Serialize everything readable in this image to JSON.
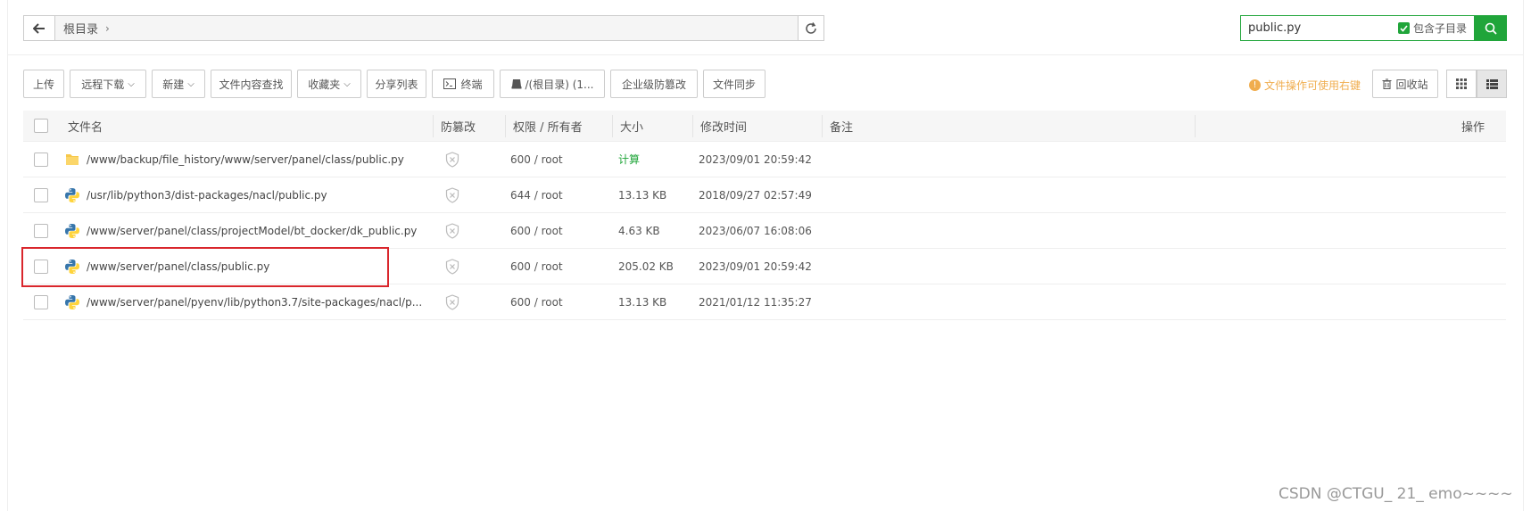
{
  "pathbar": {
    "crumb": "根目录"
  },
  "search": {
    "value": "public.py",
    "subdir_label": "包含子目录"
  },
  "toolbar": {
    "upload": "上传",
    "remote_download": "远程下载",
    "new": "新建",
    "content_search": "文件内容查找",
    "favorites": "收藏夹",
    "share_list": "分享列表",
    "terminal": "终端",
    "disk": "/(根目录) (1...",
    "tamper": "企业级防篡改",
    "sync": "文件同步",
    "tip": "文件操作可使用右键",
    "recycle": "回收站"
  },
  "table": {
    "headers": {
      "name": "文件名",
      "tamper": "防篡改",
      "perm": "权限 / 所有者",
      "size": "大小",
      "mtime": "修改时间",
      "remark": "备注",
      "ops": "操作"
    },
    "rows": [
      {
        "type": "folder",
        "name": "/www/backup/file_history/www/server/panel/class/public.py",
        "perm": "600 / root",
        "size": "计算",
        "mtime": "2023/09/01 20:59:42"
      },
      {
        "type": "python",
        "name": "/usr/lib/python3/dist-packages/nacl/public.py",
        "perm": "644 / root",
        "size": "13.13 KB",
        "mtime": "2018/09/27 02:57:49"
      },
      {
        "type": "python",
        "name": "/www/server/panel/class/projectModel/bt_docker/dk_public.py",
        "perm": "600 / root",
        "size": "4.63 KB",
        "mtime": "2023/06/07 16:08:06"
      },
      {
        "type": "python",
        "name": "/www/server/panel/class/public.py",
        "perm": "600 / root",
        "size": "205.02 KB",
        "mtime": "2023/09/01 20:59:42"
      },
      {
        "type": "python",
        "name": "/www/server/panel/pyenv/lib/python3.7/site-packages/nacl/p...",
        "perm": "600 / root",
        "size": "13.13 KB",
        "mtime": "2021/01/12 11:35:27"
      }
    ]
  },
  "watermark": "CSDN @CTGU_ 21_  emo~~~~",
  "colors": {
    "accent": "#20a53a",
    "warning": "#f0ad4e",
    "highlight": "#d9262c"
  }
}
